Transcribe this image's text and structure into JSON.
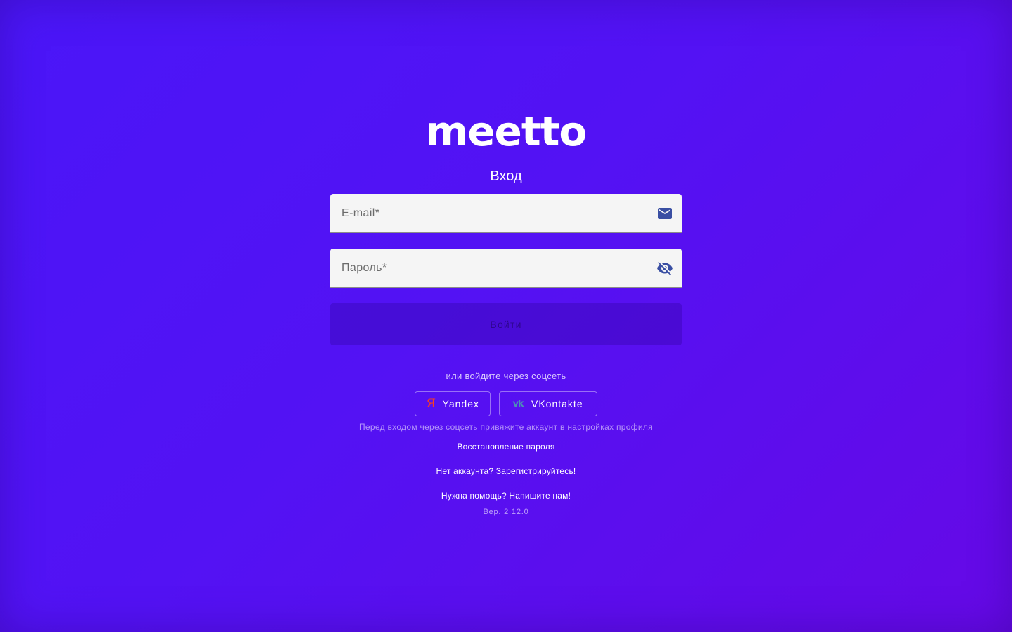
{
  "brand": {
    "logo_text": "meetto"
  },
  "login": {
    "title": "Вход",
    "email_placeholder": "E-mail*",
    "password_placeholder": "Пароль*",
    "submit_label": "Войти"
  },
  "icons": {
    "email": "mail-icon",
    "password_toggle": "eye-off-icon",
    "yandex": "yandex-logo-icon",
    "vk": "vk-logo-icon"
  },
  "social": {
    "hint": "или войдите через соцсеть",
    "yandex_glyph": "Я",
    "yandex_label": "Yandex",
    "vk_glyph": "vk",
    "vk_label": "VKontakte",
    "note": "Перед входом через соцсеть привяжите аккаунт в настройках профиля"
  },
  "links": {
    "recover": "Восстановление пароля",
    "register": "Нет аккаунта? Зарегистрируйтесь!",
    "help": "Нужна помощь? Напишите нам!"
  },
  "version": "Вер. 2.12.0",
  "colors": {
    "background_start": "#4a16f8",
    "background_end": "#6609e6",
    "field_background": "#f5f5f5",
    "field_icon": "#3a4fa3",
    "yandex_brand": "#fc3f1d",
    "vk_brand": "#4d8fb5"
  }
}
